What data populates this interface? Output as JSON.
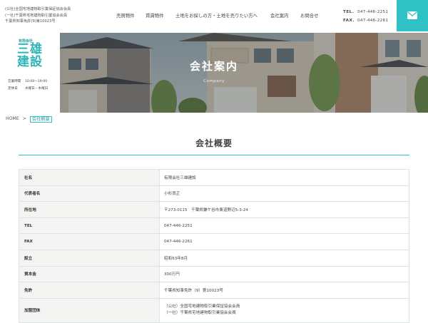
{
  "header": {
    "association_lines": [
      "(公社)全国宅地建物取引業保証協会会員",
      "(一社)千葉県宅地建物取引業協会会員",
      "千葉県知事免許(9)第10023号"
    ],
    "nav": [
      "売買物件",
      "賃貸物件",
      "土地をお探しの方・土地を売りたい方へ",
      "会社案内",
      "お問合せ"
    ],
    "tel_label": "TEL.",
    "tel_value": "047-446-2251",
    "fax_label": "FAX.",
    "fax_value": "047-446-2261",
    "mail_icon": "envelope-icon",
    "accent_color": "#2fc1c3"
  },
  "logo": {
    "small_text": "有限会社",
    "line1": "三雄",
    "line2": "建設",
    "hours_label": "営業時間",
    "hours_value": "10:00～19:00",
    "holiday_label": "定休日",
    "holiday_value": "水曜日・木曜日"
  },
  "hero": {
    "title": "会社案内",
    "subtitle": "Company"
  },
  "breadcrumb": {
    "home": "HOME",
    "separator": ">",
    "current": "会社概要"
  },
  "section": {
    "title": "会社概要"
  },
  "company_table": {
    "rows": [
      {
        "label": "社名",
        "value": "有限会社三雄建設"
      },
      {
        "label": "代表者名",
        "value": "小杉良正"
      },
      {
        "label": "所在地",
        "value": "〒273-0115　千葉県鎌ケ谷市東道野辺5-3-24"
      },
      {
        "label": "TEL",
        "value": "047-446-2251"
      },
      {
        "label": "FAX",
        "value": "047-446-2261"
      },
      {
        "label": "設立",
        "value": "昭和63年8月"
      },
      {
        "label": "資本金",
        "value": "300万円"
      },
      {
        "label": "免許",
        "value": "千葉県知事免許（9）第10023号"
      }
    ],
    "membership_label": "加盟団体",
    "membership_lines": [
      "（公社）全国宅地建物取引業保証協会会員",
      "（一社）千葉県宅地建物取引業協会会員"
    ]
  }
}
